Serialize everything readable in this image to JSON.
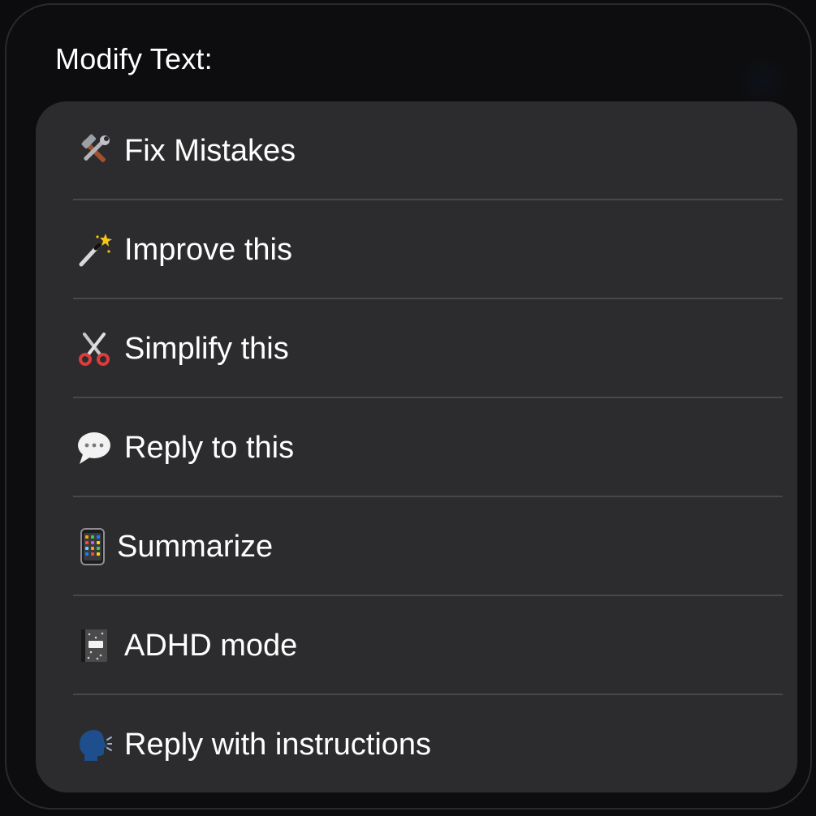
{
  "sheet": {
    "title": "Modify Text:"
  },
  "menu": {
    "items": [
      {
        "label": "Fix Mistakes",
        "icon": "hammer-and-wrench-icon"
      },
      {
        "label": "Improve this",
        "icon": "magic-wand-icon"
      },
      {
        "label": "Simplify this",
        "icon": "scissors-icon"
      },
      {
        "label": "Reply to this",
        "icon": "speech-bubble-icon"
      },
      {
        "label": "Summarize",
        "icon": "mobile-phone-icon"
      },
      {
        "label": "ADHD mode",
        "icon": "composition-notebook-icon"
      },
      {
        "label": "Reply with instructions",
        "icon": "speaking-head-icon"
      }
    ]
  },
  "colors": {
    "sheet_background": "#0e0e10",
    "menu_background": "#2c2c2e",
    "divider": "#48484a",
    "text": "#ffffff"
  }
}
